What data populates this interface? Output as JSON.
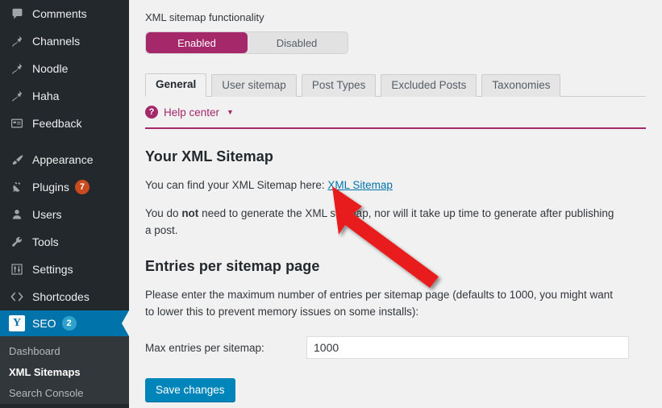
{
  "sidebar": {
    "items": [
      {
        "label": "Comments",
        "icon": "comments-icon",
        "badge": null
      },
      {
        "label": "Channels",
        "icon": "pin-icon",
        "badge": null
      },
      {
        "label": "Noodle",
        "icon": "pin-icon",
        "badge": null
      },
      {
        "label": "Haha",
        "icon": "pin-icon",
        "badge": null
      },
      {
        "label": "Feedback",
        "icon": "feedback-icon",
        "badge": null
      },
      {
        "label": "Appearance",
        "icon": "brush-icon",
        "badge": null
      },
      {
        "label": "Plugins",
        "icon": "plug-icon",
        "badge": "7"
      },
      {
        "label": "Users",
        "icon": "user-icon",
        "badge": null
      },
      {
        "label": "Tools",
        "icon": "wrench-icon",
        "badge": null
      },
      {
        "label": "Settings",
        "icon": "sliders-icon",
        "badge": null
      },
      {
        "label": "Shortcodes",
        "icon": "code-icon",
        "badge": null
      }
    ],
    "current": {
      "label": "SEO",
      "icon": "yoast-logo-icon",
      "badge": "2",
      "badge_color": "#2ea2cc",
      "bg_color": "#0073aa"
    },
    "submenu": [
      {
        "label": "Dashboard",
        "active": false
      },
      {
        "label": "XML Sitemaps",
        "active": true
      },
      {
        "label": "Search Console",
        "active": false
      }
    ]
  },
  "main": {
    "functionality_label": "XML sitemap functionality",
    "toggle": {
      "enabled_label": "Enabled",
      "disabled_label": "Disabled",
      "selected": "Enabled",
      "active_color": "#a4286a"
    },
    "tabs": [
      {
        "label": "General",
        "active": true
      },
      {
        "label": "User sitemap",
        "active": false
      },
      {
        "label": "Post Types",
        "active": false
      },
      {
        "label": "Excluded Posts",
        "active": false
      },
      {
        "label": "Taxonomies",
        "active": false
      }
    ],
    "help_center": {
      "label": "Help center",
      "icon": "question-mark-icon",
      "caret": "▼",
      "accent_color": "#a4286a"
    },
    "sitemap_section": {
      "heading": "Your XML Sitemap",
      "intro_prefix": "You can find your XML Sitemap here: ",
      "link_label": "XML Sitemap",
      "note_part1": "You do ",
      "note_bold": "not",
      "note_part2": " need to generate the XML sitemap, nor will it take up time to generate after publishing a post."
    },
    "entries_section": {
      "heading": "Entries per sitemap page",
      "description": "Please enter the maximum number of entries per sitemap page (defaults to 1000, you might want to lower this to prevent memory issues on some installs):",
      "field_label": "Max entries per sitemap:",
      "field_value": "1000"
    },
    "save_label": "Save changes",
    "save_color": "#0085ba"
  },
  "annotation": {
    "arrow_color": "#e81b1b",
    "arrow_name": "red-pointer-arrow",
    "points_at": "XML Sitemap"
  }
}
